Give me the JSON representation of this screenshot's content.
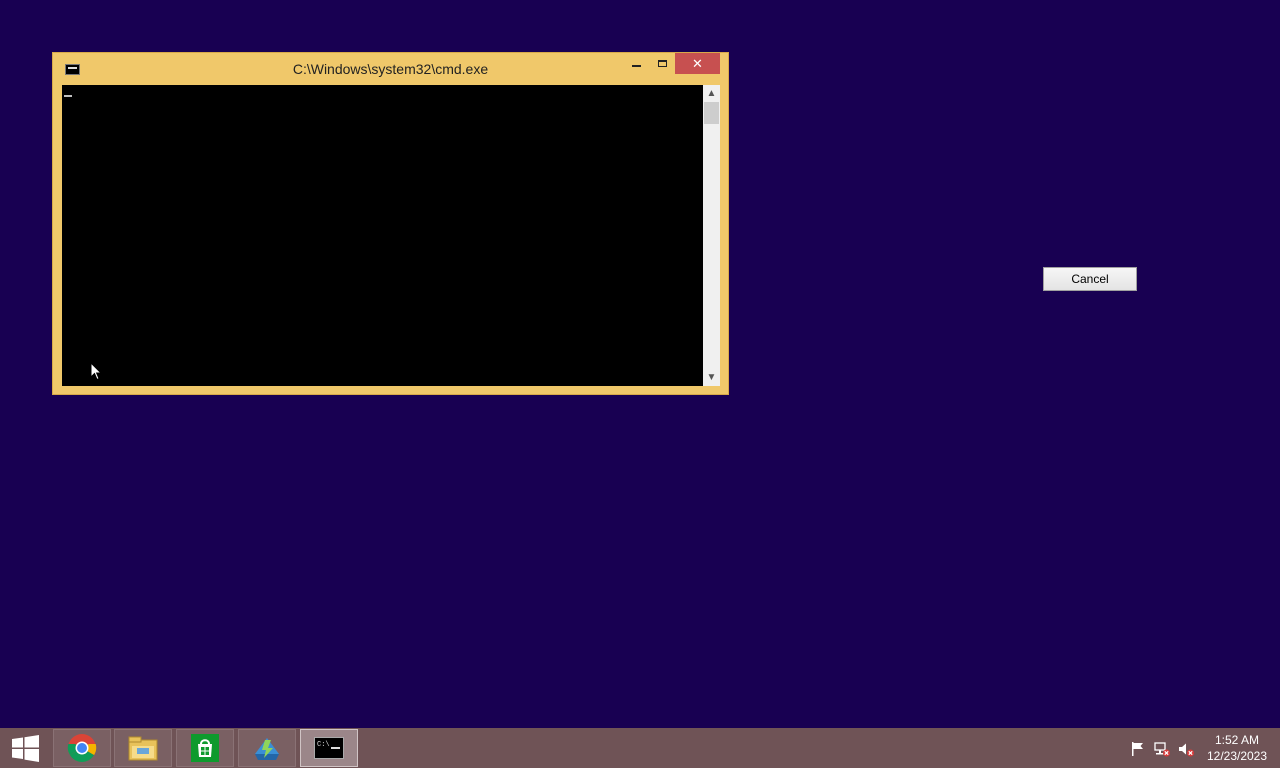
{
  "window": {
    "title": "C:\\Windows\\system32\\cmd.exe",
    "close_glyph": "✕",
    "scroll_up_glyph": "▲",
    "scroll_down_glyph": "▼"
  },
  "dialog": {
    "cancel_label": "Cancel"
  },
  "taskbar": {
    "items": [
      "chrome-icon",
      "file-explorer-icon",
      "store-icon",
      "flux-icon",
      "command-prompt-icon"
    ],
    "active_item": "command-prompt-icon",
    "clock": {
      "time": "1:52 AM",
      "date": "12/23/2023"
    }
  },
  "colors": {
    "desktop": "#180052",
    "window_frame": "#f0c86a",
    "close_button": "#c75050",
    "taskbar": "#6f5356"
  }
}
